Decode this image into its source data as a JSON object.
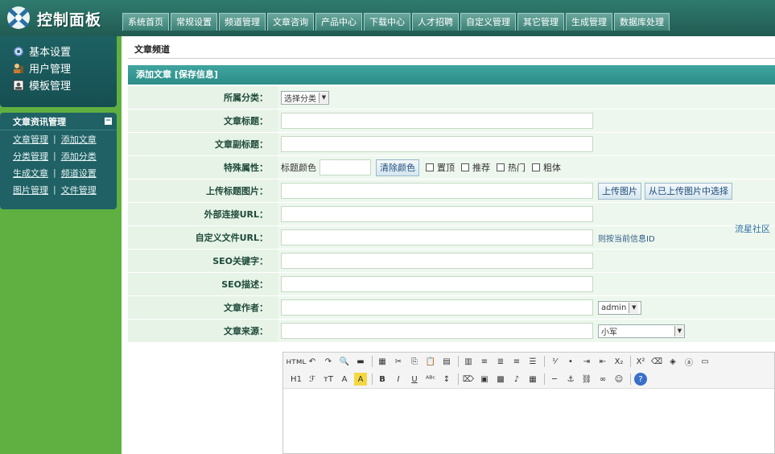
{
  "header": {
    "logo_text": "控制面板",
    "nav": [
      "系统首页",
      "常规设置",
      "频道管理",
      "文章咨询",
      "产品中心",
      "下载中心",
      "人才招聘",
      "自定义管理",
      "其它管理",
      "生成管理",
      "数据库处理"
    ]
  },
  "sidebar": {
    "quick": [
      {
        "label": "基本设置",
        "icon": "gear-icon"
      },
      {
        "label": "用户管理",
        "icon": "user-icon"
      },
      {
        "label": "模板管理",
        "icon": "template-icon"
      }
    ],
    "panel_title": "文章资讯管理",
    "panel_rows": [
      [
        "文章管理",
        "添加文章"
      ],
      [
        "分类管理",
        "添加分类"
      ],
      [
        "生成文章",
        "频道设置"
      ],
      [
        "图片管理",
        "文件管理"
      ]
    ]
  },
  "main": {
    "breadcrumb": "文章频道",
    "form_title": "添加文章 [保存信息]",
    "labels": {
      "category": "所属分类：",
      "title": "文章标题：",
      "subtitle": "文章副标题：",
      "special": "特殊属性：",
      "upload_image": "上传标题图片：",
      "external_url": "外部连接URL：",
      "custom_file_url": "自定义文件URL：",
      "seo_keywords": "SEO关键字：",
      "seo_desc": "SEO描述：",
      "author": "文章作者：",
      "source": "文章来源："
    },
    "category_select": "选择分类",
    "title_color_label": "标题颜色",
    "clear_color_button": "清除颜色",
    "checkboxes": [
      "置顶",
      "推荐",
      "热门",
      "粗体"
    ],
    "upload_button": "上传图片",
    "choose_uploaded_button": "从已上传图片中选择",
    "custom_url_hint": "则按当前信息ID",
    "author_select": "admin",
    "source_select": "小军"
  },
  "editor": {
    "row1": [
      "HTML",
      "undo",
      "redo",
      "preview",
      "print",
      "template",
      "cut",
      "copy",
      "paste",
      "paste-text",
      "paste-word",
      "left",
      "center",
      "right",
      "justify",
      "ol",
      "ul",
      "indent",
      "outdent",
      "sub",
      "sup",
      "clear",
      "select-all",
      "special-char",
      "source"
    ],
    "row2": [
      "H1",
      "F",
      "tT",
      "A",
      "A",
      "B",
      "I",
      "U",
      "ABC",
      "line-height",
      "eraser",
      "image",
      "flash",
      "media",
      "table",
      "hr",
      "anchor",
      "link",
      "unlink",
      "emoticon",
      "help"
    ]
  },
  "watermark": "流星社区",
  "colors": {
    "header_bg": "#2f7a6e",
    "sidebar_bg": "#5fb040",
    "panel_bg": "#1f6165",
    "form_title_bg": "#3fa4a0",
    "label_bg": "#e7f3e7"
  }
}
